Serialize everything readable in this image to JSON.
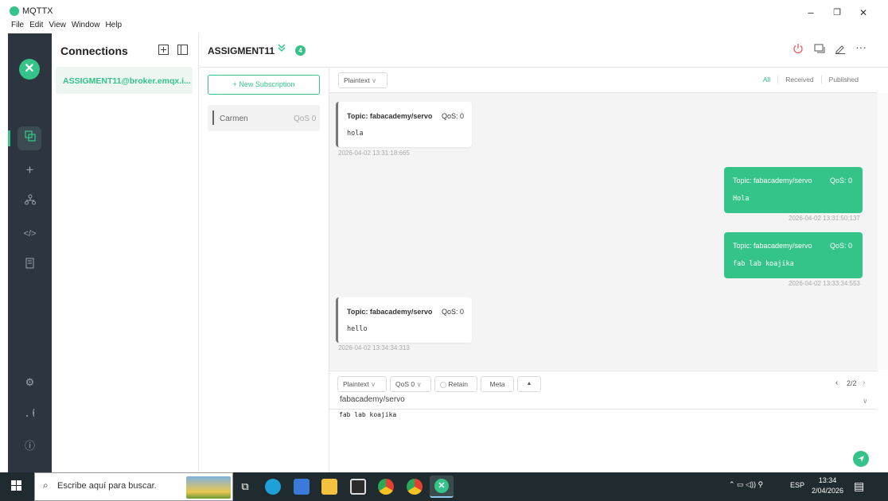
{
  "window": {
    "title": "MQTTX",
    "menu": [
      "File",
      "Edit",
      "View",
      "Window",
      "Help"
    ],
    "controls": {
      "minimize": "–",
      "maximize": "❐",
      "close": "✕"
    }
  },
  "nav": {
    "logo": "✕",
    "icons": [
      "connections-icon",
      "plus-icon",
      "topology-icon",
      "code-icon",
      "log-icon",
      "settings-icon",
      "feed-icon",
      "info-icon"
    ]
  },
  "connections": {
    "title": "Connections",
    "items": [
      {
        "label": "ASSIGMENT11@broker.emqx.i..."
      }
    ]
  },
  "header": {
    "connection_name": "ASSIGMENT11",
    "count": "4"
  },
  "subscriptions": {
    "new_label": "+ New Subscription",
    "items": [
      {
        "name": "Carmen",
        "qos": "QoS 0"
      }
    ]
  },
  "messages_toolbar": {
    "format": "Plaintext",
    "filters": [
      "All",
      "Received",
      "Published"
    ]
  },
  "messages": [
    {
      "dir": "in",
      "topic": "Topic: fabacademy/servo",
      "qos": "QoS: 0",
      "payload": "hola",
      "time": "2026-04-02 13:31:18:665"
    },
    {
      "dir": "out",
      "topic": "Topic: fabacademy/servo",
      "qos": "QoS: 0",
      "payload": "Hola",
      "time": "2026-04-02 13:31:50:137"
    },
    {
      "dir": "out",
      "topic": "Topic: fabacademy/servo",
      "qos": "QoS: 0",
      "payload": "fab lab koajika",
      "time": "2026-04-02 13:33:34:553"
    },
    {
      "dir": "in",
      "topic": "Topic: fabacademy/servo",
      "qos": "QoS: 0",
      "payload": "hello",
      "time": "2026-04-02 13:34:34:313"
    }
  ],
  "composer": {
    "format": "Plaintext",
    "qos": "QoS 0",
    "retain": "Retain",
    "meta": "Meta",
    "page": "2/2",
    "topic": "fabacademy/servo",
    "payload": "fab lab koajika"
  },
  "taskbar": {
    "search_placeholder": "Escribe aquí para buscar.",
    "lang": "ESP",
    "time": "13:34",
    "date": "2/04/2026"
  },
  "colors": {
    "accent": "#34c388",
    "nav_bg": "#2d3640"
  }
}
